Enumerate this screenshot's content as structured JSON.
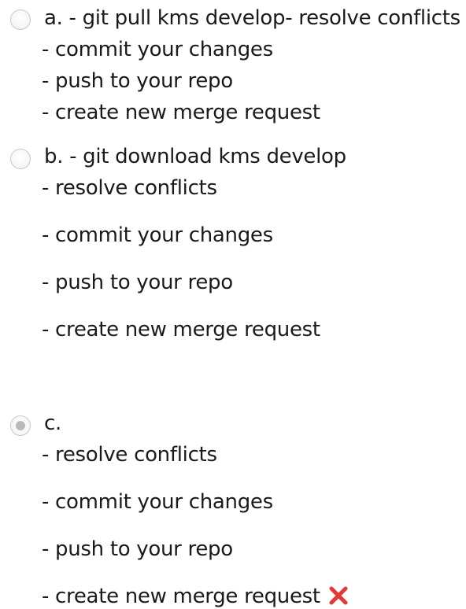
{
  "options": [
    {
      "selected": false,
      "lines": [
        "a. - git pull kms develop- resolve conflicts",
        "- commit your changes",
        "- push to your repo",
        "- create new merge request"
      ]
    },
    {
      "selected": false,
      "lines": [
        "b. - git download kms develop",
        "- resolve conflicts",
        "- commit your changes",
        "- push to your repo",
        "- create new merge request"
      ]
    },
    {
      "selected": true,
      "lines": [
        "c.",
        "- resolve conflicts",
        "- commit your changes",
        "- push to your repo",
        "- create new merge request"
      ]
    }
  ],
  "feedback": {
    "icon": "cross-mark-icon",
    "status": "incorrect",
    "color": "#e53935"
  }
}
